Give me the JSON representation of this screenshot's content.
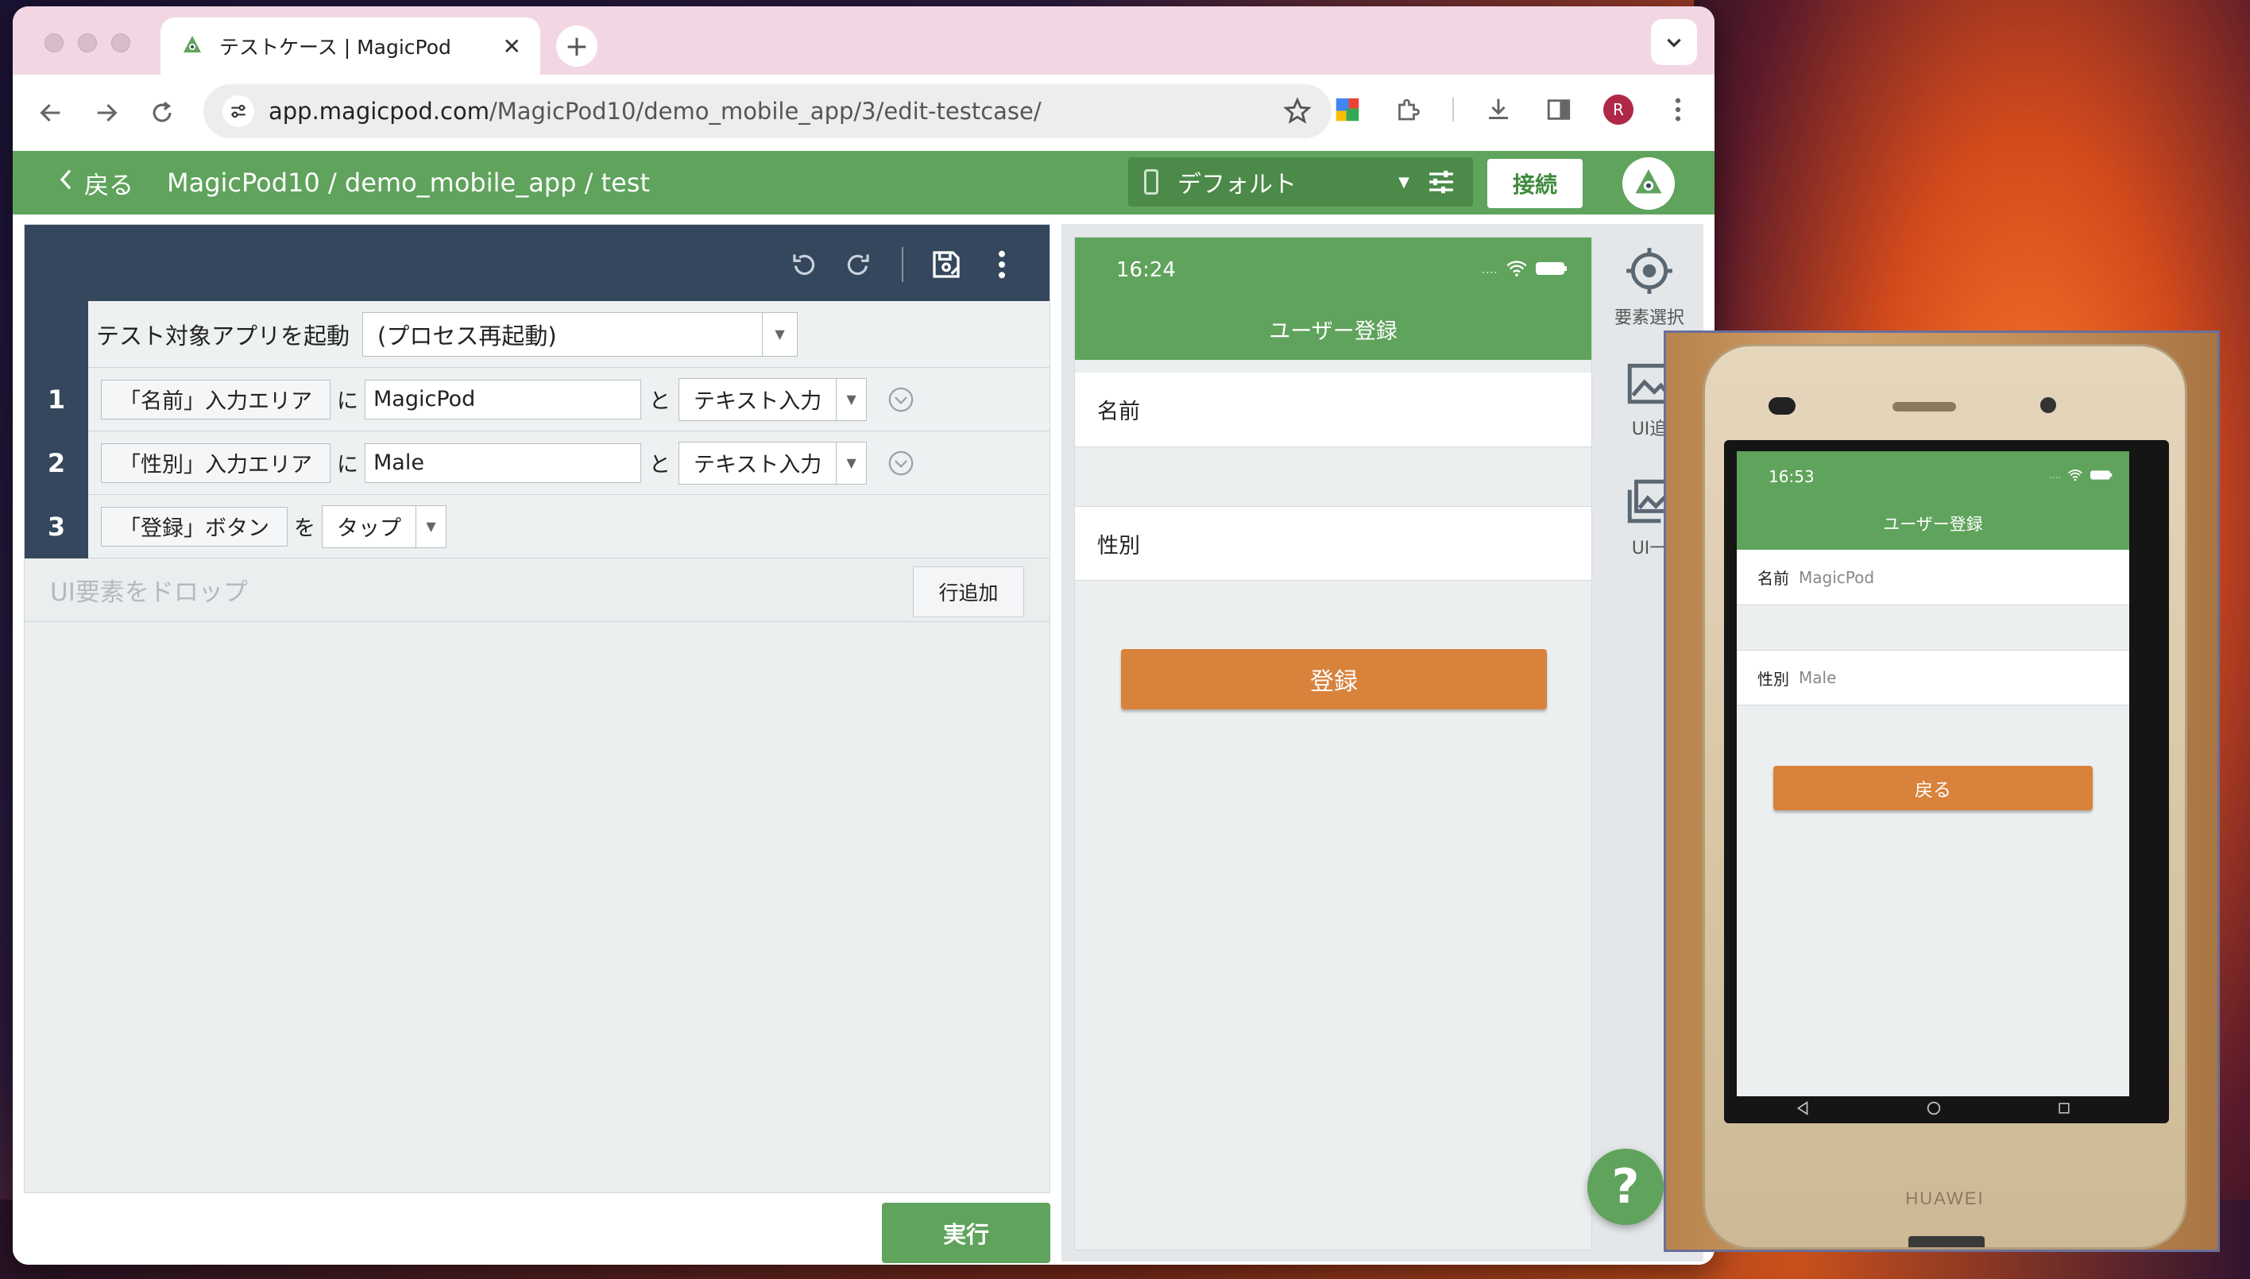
{
  "browser": {
    "tab_title": "テストケース | MagicPod",
    "tab_close": "✕",
    "new_tab": "+",
    "url_host": "app.magicpod.com",
    "url_path": "/MagicPod10/demo_mobile_app/3/edit-testcase/",
    "profile_initial": "R"
  },
  "header": {
    "back_label": "戻る",
    "breadcrumb": "MagicPod10 / demo_mobile_app / test",
    "device_label": "デフォルト",
    "connect_label": "接続",
    "brand_color": "#5fa35c"
  },
  "editor": {
    "launch_step": {
      "label": "テスト対象アプリを起動",
      "option": "(プロセス再起動)"
    },
    "steps": [
      {
        "num": "1",
        "target": "「名前」入力エリア",
        "particle1": "に",
        "value": "MagicPod",
        "particle2": "と",
        "action": "テキスト入力"
      },
      {
        "num": "2",
        "target": "「性別」入力エリア",
        "particle1": "に",
        "value": "Male",
        "particle2": "と",
        "action": "テキスト入力"
      },
      {
        "num": "3",
        "target": "「登録」ボタン",
        "particle1": "を",
        "action": "タップ"
      }
    ],
    "drop_hint": "UI要素をドロップ",
    "add_row_label": "行追加",
    "run_label": "実行"
  },
  "preview": {
    "time": "16:24",
    "title": "ユーザー登録",
    "field_name": "名前",
    "field_gender": "性別",
    "button_label": "登録",
    "button_color": "#d8823c"
  },
  "side_tools": {
    "select_element": "要素選択",
    "add_ui": "UI追",
    "ui_other": "UI一"
  },
  "help": {
    "label": "?"
  },
  "camera": {
    "time": "16:53",
    "title": "ユーザー登録",
    "field_name_label": "名前",
    "field_name_value": "MagicPod",
    "field_gender_label": "性別",
    "field_gender_value": "Male",
    "button_label": "戻る",
    "brand": "HUAWEI"
  }
}
